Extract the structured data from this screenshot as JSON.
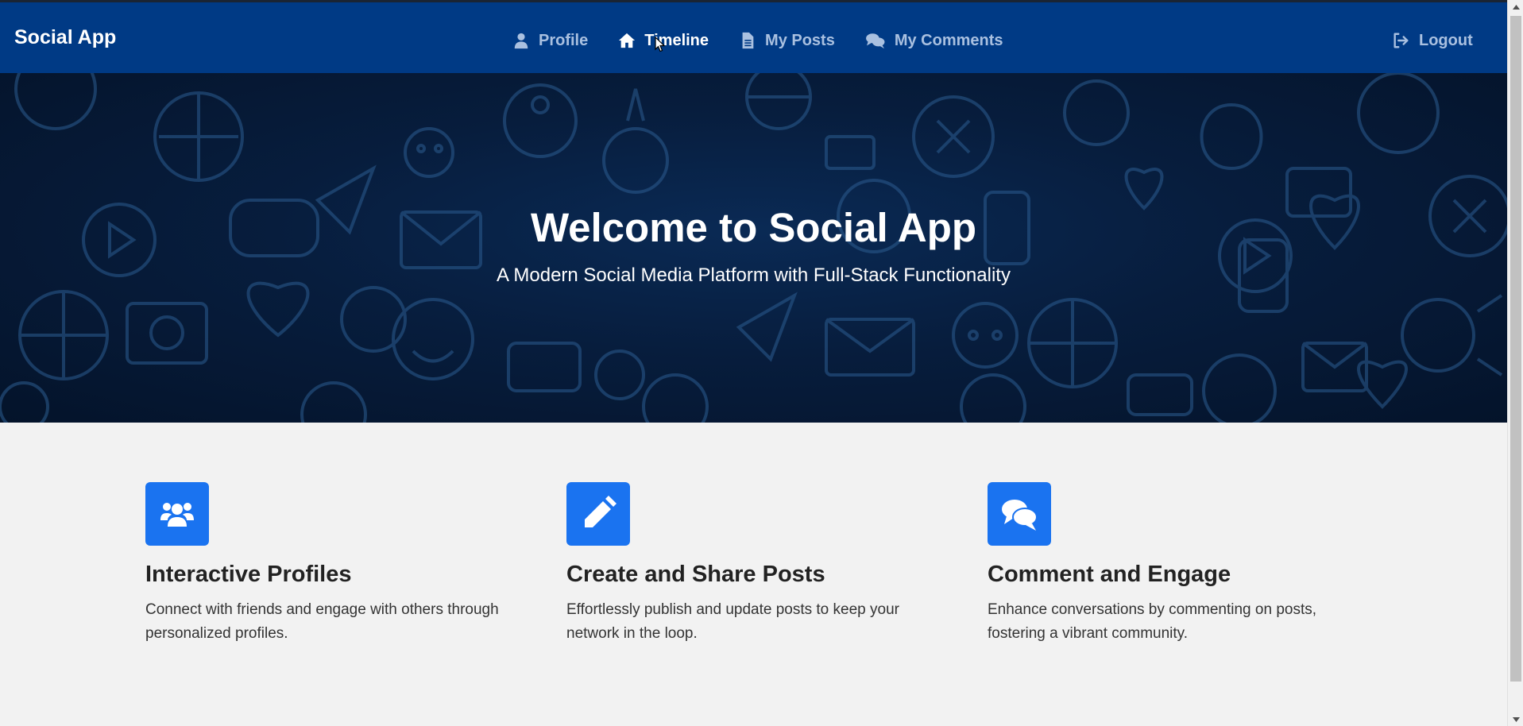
{
  "app": {
    "brand": "Social App"
  },
  "nav": {
    "items": [
      {
        "label": "Profile",
        "icon": "user-icon",
        "active": false
      },
      {
        "label": "Timeline",
        "icon": "home-icon",
        "active": true
      },
      {
        "label": "My Posts",
        "icon": "file-icon",
        "active": false
      },
      {
        "label": "My Comments",
        "icon": "comments-icon",
        "active": false
      }
    ],
    "logout": {
      "label": "Logout",
      "icon": "sign-out-icon"
    }
  },
  "hero": {
    "title": "Welcome to Social App",
    "subtitle": "A Modern Social Media Platform with Full-Stack Functionality"
  },
  "features": [
    {
      "icon": "users-icon",
      "title": "Interactive Profiles",
      "text": "Connect with friends and engage with others through personalized profiles."
    },
    {
      "icon": "pencil-icon",
      "title": "Create and Share Posts",
      "text": "Effortlessly publish and update posts to keep your network in the loop."
    },
    {
      "icon": "comments-icon",
      "title": "Comment and Engage",
      "text": "Enhance conversations by commenting on posts, fostering a vibrant community."
    }
  ],
  "colors": {
    "navbar": "#003a85",
    "nav_link": "#a9c0e0",
    "nav_active": "#ffffff",
    "hero_bg": "#071d3d",
    "feature_badge": "#1a73f0",
    "page_bg": "#f2f2f2"
  }
}
